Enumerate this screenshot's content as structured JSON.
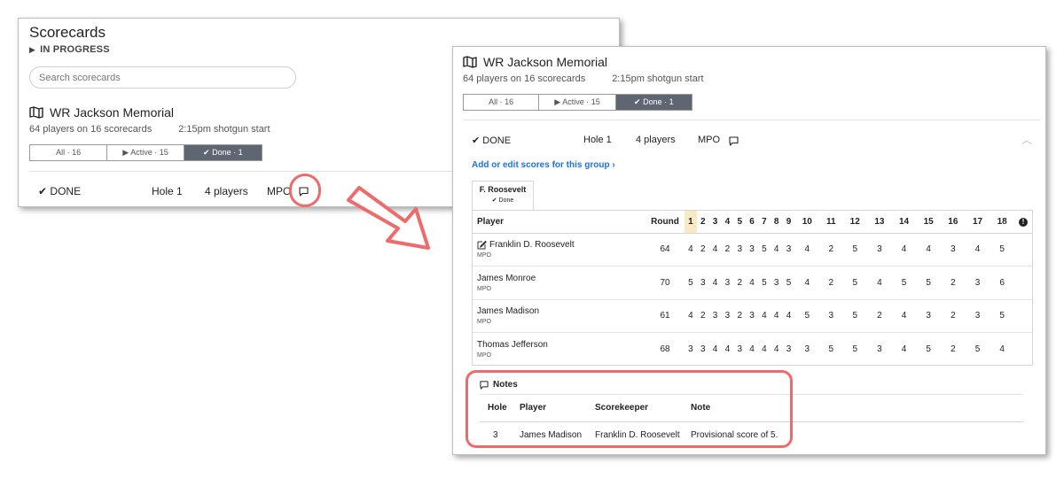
{
  "left": {
    "title": "Scorecards",
    "status": "IN PROGRESS",
    "search_placeholder": "Search scorecards",
    "event": {
      "name": "WR Jackson Memorial",
      "players_meta": "64 players on 16 scorecards",
      "start_meta": "2:15pm shotgun start"
    },
    "filters": [
      "All · 16",
      "Active · 15",
      "Done · 1"
    ],
    "group": {
      "status": "DONE",
      "hole": "Hole 1",
      "players": "4 players",
      "division": "MPO"
    }
  },
  "right": {
    "event": {
      "name": "WR Jackson Memorial",
      "players_meta": "64 players on 16 scorecards",
      "start_meta": "2:15pm shotgun start"
    },
    "filters": [
      "All · 16",
      "Active · 15",
      "Done · 1"
    ],
    "group": {
      "status": "DONE",
      "hole": "Hole 1",
      "players": "4 players",
      "division": "MPO"
    },
    "edit_link": "Add or edit scores for this group ›",
    "card_tab": {
      "name": "F. Roosevelt",
      "status": "Done"
    },
    "scorecard": {
      "headers": {
        "player": "Player",
        "round": "Round"
      },
      "holes": [
        "1",
        "2",
        "3",
        "4",
        "5",
        "6",
        "7",
        "8",
        "9",
        "10",
        "11",
        "12",
        "13",
        "14",
        "15",
        "16",
        "17",
        "18"
      ],
      "rows": [
        {
          "name": "Franklin D. Roosevelt",
          "division": "MPO",
          "round": "64",
          "scores": [
            "4",
            "2",
            "4",
            "2",
            "3",
            "3",
            "5",
            "4",
            "3",
            "4",
            "2",
            "5",
            "3",
            "4",
            "4",
            "3",
            "4",
            "5"
          ]
        },
        {
          "name": "James Monroe",
          "division": "MPO",
          "round": "70",
          "scores": [
            "5",
            "3",
            "4",
            "3",
            "2",
            "4",
            "5",
            "3",
            "5",
            "4",
            "2",
            "5",
            "4",
            "5",
            "5",
            "2",
            "3",
            "6"
          ]
        },
        {
          "name": "James Madison",
          "division": "MPO",
          "round": "61",
          "scores": [
            "4",
            "2",
            "3",
            "3",
            "2",
            "3",
            "4",
            "4",
            "4",
            "5",
            "3",
            "5",
            "2",
            "4",
            "3",
            "2",
            "3",
            "5"
          ]
        },
        {
          "name": "Thomas Jefferson",
          "division": "MPO",
          "round": "68",
          "scores": [
            "3",
            "3",
            "4",
            "4",
            "3",
            "4",
            "4",
            "4",
            "3",
            "3",
            "5",
            "5",
            "3",
            "4",
            "5",
            "2",
            "5",
            "4"
          ]
        }
      ]
    },
    "notes": {
      "title": "Notes",
      "headers": {
        "hole": "Hole",
        "player": "Player",
        "scorekeeper": "Scorekeeper",
        "note": "Note"
      },
      "rows": [
        {
          "hole": "3",
          "player": "James Madison",
          "scorekeeper": "Franklin D. Roosevelt",
          "note": "Provisional score of 5."
        }
      ]
    }
  },
  "colors": {
    "accent_callout": "#ef6a6a",
    "link": "#1a73e8",
    "selected_segment": "#5f6671",
    "highlight_hole": "#fbe9c6"
  }
}
